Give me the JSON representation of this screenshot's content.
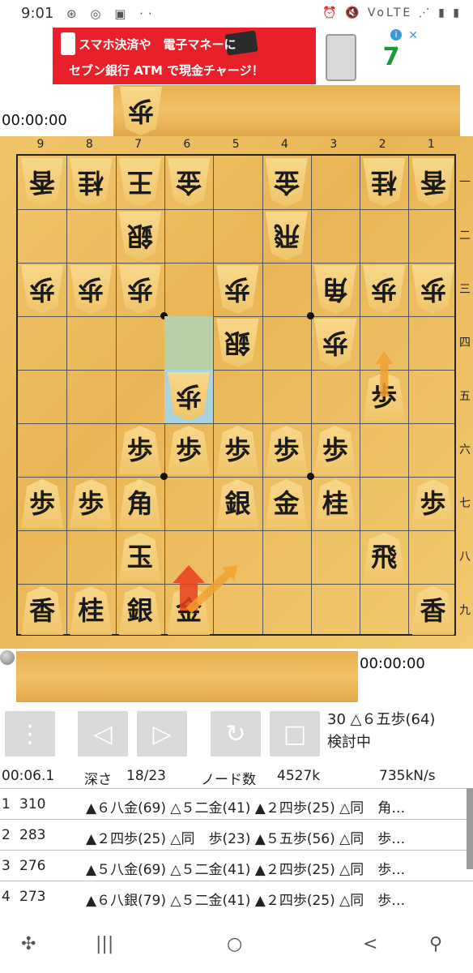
{
  "status_bar": {
    "time": "9:01",
    "left_icons": "⊛ ◎ ▣ ··",
    "right_icons": "⏰ 🔇 VoLTE ⋰ ▮ ▮"
  },
  "ad": {
    "line1": "スマホ決済や　電子マネーに",
    "line2": "セブン銀行 ATM で現金チャージ！",
    "info_icon": "i",
    "close_icon": "✕",
    "logo": "7"
  },
  "players": {
    "top_timer": "00:00:00",
    "bottom_timer": "00:00:00",
    "top_hand": [
      "歩"
    ]
  },
  "board": {
    "files": [
      "9",
      "8",
      "7",
      "6",
      "5",
      "4",
      "3",
      "2",
      "1"
    ],
    "ranks": [
      "一",
      "二",
      "三",
      "四",
      "五",
      "六",
      "七",
      "八",
      "九"
    ],
    "pieces": [
      {
        "file": 9,
        "rank": 1,
        "k": "香",
        "side": "gote"
      },
      {
        "file": 8,
        "rank": 1,
        "k": "桂",
        "side": "gote"
      },
      {
        "file": 7,
        "rank": 1,
        "k": "王",
        "side": "gote"
      },
      {
        "file": 6,
        "rank": 1,
        "k": "金",
        "side": "gote"
      },
      {
        "file": 4,
        "rank": 1,
        "k": "金",
        "side": "gote"
      },
      {
        "file": 2,
        "rank": 1,
        "k": "桂",
        "side": "gote"
      },
      {
        "file": 1,
        "rank": 1,
        "k": "香",
        "side": "gote"
      },
      {
        "file": 7,
        "rank": 2,
        "k": "銀",
        "side": "gote"
      },
      {
        "file": 4,
        "rank": 2,
        "k": "飛",
        "side": "gote"
      },
      {
        "file": 9,
        "rank": 3,
        "k": "歩",
        "side": "gote"
      },
      {
        "file": 8,
        "rank": 3,
        "k": "歩",
        "side": "gote"
      },
      {
        "file": 7,
        "rank": 3,
        "k": "歩",
        "side": "gote"
      },
      {
        "file": 5,
        "rank": 3,
        "k": "歩",
        "side": "gote"
      },
      {
        "file": 3,
        "rank": 3,
        "k": "角",
        "side": "gote"
      },
      {
        "file": 2,
        "rank": 3,
        "k": "歩",
        "side": "gote"
      },
      {
        "file": 1,
        "rank": 3,
        "k": "歩",
        "side": "gote"
      },
      {
        "file": 5,
        "rank": 4,
        "k": "銀",
        "side": "gote"
      },
      {
        "file": 3,
        "rank": 4,
        "k": "歩",
        "side": "gote"
      },
      {
        "file": 6,
        "rank": 5,
        "k": "歩",
        "side": "gote"
      },
      {
        "file": 2,
        "rank": 5,
        "k": "歩",
        "side": "sente"
      },
      {
        "file": 7,
        "rank": 6,
        "k": "歩",
        "side": "sente"
      },
      {
        "file": 6,
        "rank": 6,
        "k": "歩",
        "side": "sente"
      },
      {
        "file": 5,
        "rank": 6,
        "k": "歩",
        "side": "sente"
      },
      {
        "file": 4,
        "rank": 6,
        "k": "歩",
        "side": "sente"
      },
      {
        "file": 3,
        "rank": 6,
        "k": "歩",
        "side": "sente"
      },
      {
        "file": 9,
        "rank": 7,
        "k": "歩",
        "side": "sente"
      },
      {
        "file": 8,
        "rank": 7,
        "k": "歩",
        "side": "sente"
      },
      {
        "file": 7,
        "rank": 7,
        "k": "角",
        "side": "sente"
      },
      {
        "file": 5,
        "rank": 7,
        "k": "銀",
        "side": "sente"
      },
      {
        "file": 4,
        "rank": 7,
        "k": "金",
        "side": "sente"
      },
      {
        "file": 3,
        "rank": 7,
        "k": "桂",
        "side": "sente"
      },
      {
        "file": 1,
        "rank": 7,
        "k": "歩",
        "side": "sente"
      },
      {
        "file": 7,
        "rank": 8,
        "k": "玉",
        "side": "sente"
      },
      {
        "file": 2,
        "rank": 8,
        "k": "飛",
        "side": "sente"
      },
      {
        "file": 9,
        "rank": 9,
        "k": "香",
        "side": "sente"
      },
      {
        "file": 8,
        "rank": 9,
        "k": "桂",
        "side": "sente"
      },
      {
        "file": 7,
        "rank": 9,
        "k": "銀",
        "side": "sente"
      },
      {
        "file": 6,
        "rank": 9,
        "k": "金",
        "side": "sente"
      },
      {
        "file": 1,
        "rank": 9,
        "k": "香",
        "side": "sente"
      }
    ],
    "last_move_from": {
      "file": 6,
      "rank": 4
    },
    "last_move_to": {
      "file": 6,
      "rank": 5
    },
    "highlight_colors": {
      "from": "#b9cfa8",
      "to": "#a9d3de"
    },
    "arrows": [
      {
        "from": {
          "file": 6,
          "rank": 9
        },
        "to": {
          "file": 6,
          "rank": 8
        },
        "color": "#e8401c",
        "kind": "best"
      },
      {
        "from": {
          "file": 6,
          "rank": 9
        },
        "to": {
          "file": 5,
          "rank": 8
        },
        "color": "#f0a030",
        "kind": "alt"
      },
      {
        "from": {
          "file": 2,
          "rank": 5
        },
        "to": {
          "file": 2,
          "rank": 4
        },
        "color": "#f0a030",
        "kind": "alt"
      }
    ]
  },
  "controls": {
    "menu_icon": "⋮",
    "prev_icon": "◁",
    "next_icon": "▷",
    "refresh_icon": "↻",
    "stop_icon": "□",
    "move_label": "30 △６五歩(64)",
    "status": "検討中"
  },
  "analysis": {
    "time": "00:06.1",
    "depth_label": "深さ",
    "depth": "18/23",
    "nodes_label": "ノード数",
    "nodes": "4527k",
    "nps": "735kN/s",
    "pv": [
      {
        "n": "1",
        "score": "310",
        "moves": "▲６八金(69) △５二金(41) ▲２四歩(25) △同　角…"
      },
      {
        "n": "2",
        "score": "283",
        "moves": "▲２四歩(25) △同　歩(23) ▲５五歩(56) △同　歩…"
      },
      {
        "n": "3",
        "score": "276",
        "moves": "▲５八金(69) △５二金(41) ▲２四歩(25) △同　歩…"
      },
      {
        "n": "4",
        "score": "273",
        "moves": "▲６八銀(79) △５二金(41) ▲２四歩(25) △同　歩…"
      }
    ]
  },
  "navbar": {
    "game_icon": "✣",
    "recent_icon": "|||",
    "home_icon": "○",
    "back_icon": "<",
    "access_icon": "⚲"
  }
}
